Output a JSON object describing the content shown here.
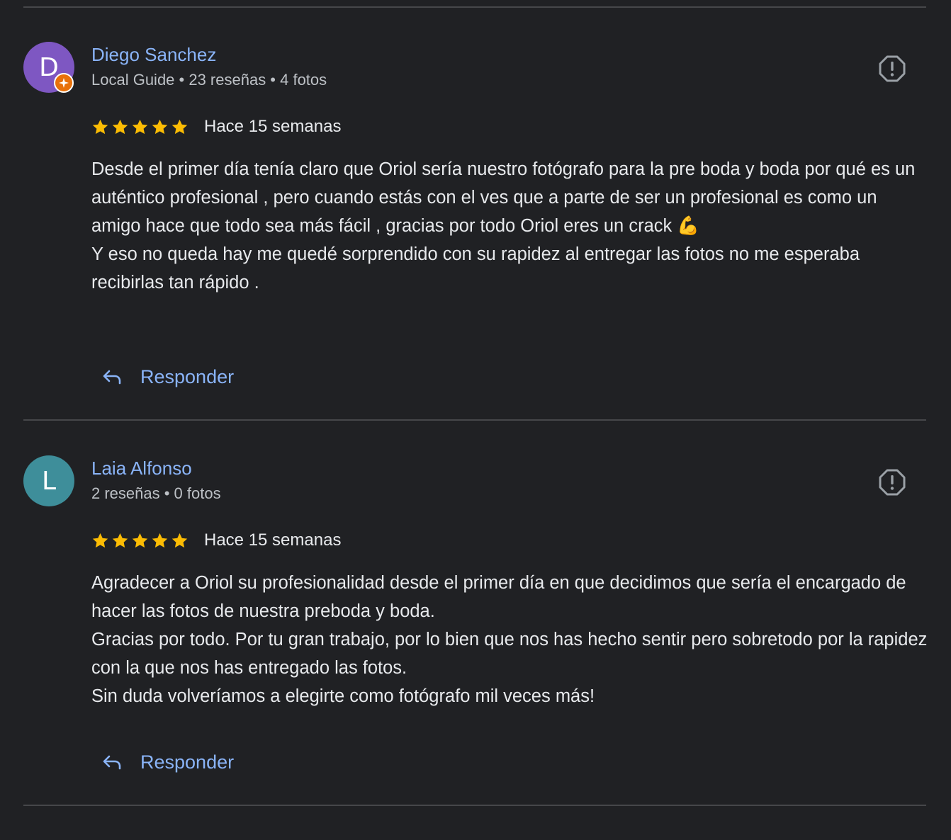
{
  "reviews": [
    {
      "author": {
        "initial": "D",
        "name": "Diego Sanchez",
        "meta": "Local Guide • 23 reseñas • 4 fotos",
        "avatar_color": "#7e57c2",
        "local_guide_badge": true
      },
      "rating": 5,
      "date": "Hace 15 semanas",
      "paragraphs": [
        "Desde el primer día tenía claro que Oriol sería nuestro fotógrafo para la pre boda y boda por qué es un auténtico profesional , pero cuando estás con el ves que a parte de ser un profesional es como un amigo hace que todo sea más fácil , gracias por todo Oriol eres un crack 💪",
        "Y eso no queda hay me quedé sorprendido con su rapidez al entregar las fotos no me esperaba recibirlas tan rápido ."
      ],
      "reply_label": "Responder",
      "flag_icon": "report-flag-icon"
    },
    {
      "author": {
        "initial": "L",
        "name": "Laia Alfonso",
        "meta": "2 reseñas • 0 fotos",
        "avatar_color": "#3e8e9a",
        "local_guide_badge": false
      },
      "rating": 5,
      "date": "Hace 15 semanas",
      "paragraphs": [
        "Agradecer a Oriol su profesionalidad desde el primer día en que decidimos que sería el encargado de hacer las fotos de nuestra preboda y boda.",
        "Gracias por todo. Por tu gran trabajo, por lo bien que nos has hecho sentir pero sobretodo por la rapidez con la que nos has entregado las fotos.",
        "Sin duda volveríamos a elegirte como fotógrafo mil veces más!"
      ],
      "reply_label": "Responder",
      "flag_icon": "report-flag-icon"
    }
  ],
  "colors": {
    "background": "#202124",
    "link": "#8ab4f8",
    "star": "#fbbc04",
    "divider": "#46474a"
  }
}
